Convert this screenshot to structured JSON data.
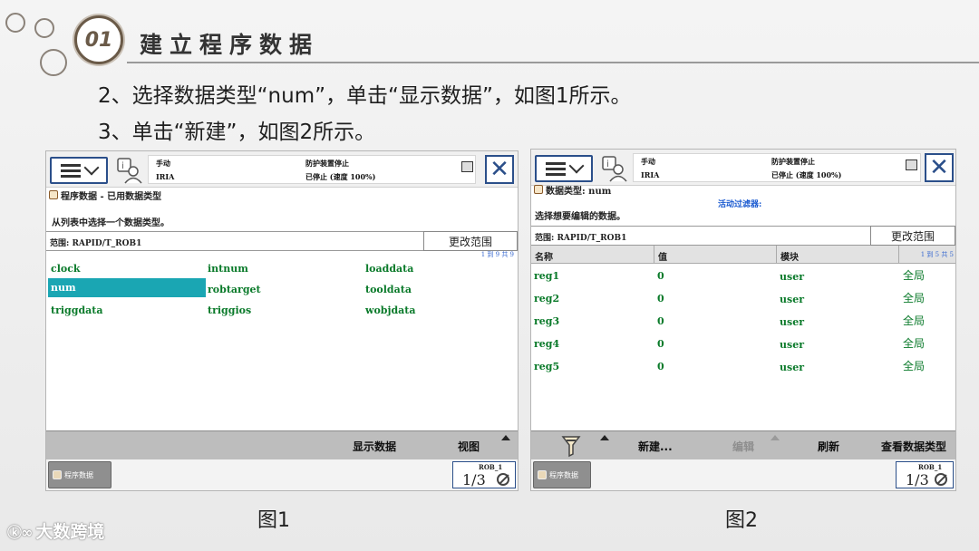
{
  "header": {
    "number": "01",
    "title": "建立程序数据",
    "instructions": [
      "2、选择数据类型“num”，单击“显示数据”，如图1所示。",
      "3、单击“新建”，如图2所示。"
    ]
  },
  "fig1": {
    "status_mode": "手动",
    "status_controller": "IRIA",
    "status_safety": "防护装置停止",
    "status_state": "已停止 (速度 100%)",
    "title": "程序数据 - 已用数据类型",
    "prompt": "从列表中选择一个数据类型。",
    "range_label": "范围: RAPID/T_ROB1",
    "change_range": "更改范围",
    "count": "1 到 9 共 9",
    "types": [
      "clock",
      "intnum",
      "loaddata",
      "num",
      "robtarget",
      "tooldata",
      "triggdata",
      "triggios",
      "wobjdata"
    ],
    "selected": "num",
    "show_data": "显示数据",
    "view": "视图",
    "task_button": "程序数据",
    "rob_label": "ROB_1",
    "rob_fraction": "1/3",
    "caption": "图1"
  },
  "fig2": {
    "status_mode": "手动",
    "status_controller": "IRIA",
    "status_safety": "防护装置停止",
    "status_state": "已停止 (速度 100%)",
    "title": "数据类型: num",
    "filter_label": "活动过滤器:",
    "prompt": "选择想要编辑的数据。",
    "range_label": "范围: RAPID/T_ROB1",
    "change_range": "更改范围",
    "count": "1 到 5 共 5",
    "columns": [
      "名称",
      "值",
      "模块"
    ],
    "rows": [
      {
        "name": "reg1",
        "value": "0",
        "module": "user",
        "scope": "全局"
      },
      {
        "name": "reg2",
        "value": "0",
        "module": "user",
        "scope": "全局"
      },
      {
        "name": "reg3",
        "value": "0",
        "module": "user",
        "scope": "全局"
      },
      {
        "name": "reg4",
        "value": "0",
        "module": "user",
        "scope": "全局"
      },
      {
        "name": "reg5",
        "value": "0",
        "module": "user",
        "scope": "全局"
      }
    ],
    "new_btn": "新建...",
    "edit_btn": "编辑",
    "refresh_btn": "刷新",
    "view_types_btn": "查看数据类型",
    "task_button": "程序数据",
    "rob_label": "ROB_1",
    "rob_fraction": "1/3",
    "caption": "图2"
  },
  "logo_text": "大数跨境",
  "colors": {
    "selection": "#1aa6b3",
    "data_text": "#0a7a2a",
    "frame_blue": "#2b4f8a"
  }
}
